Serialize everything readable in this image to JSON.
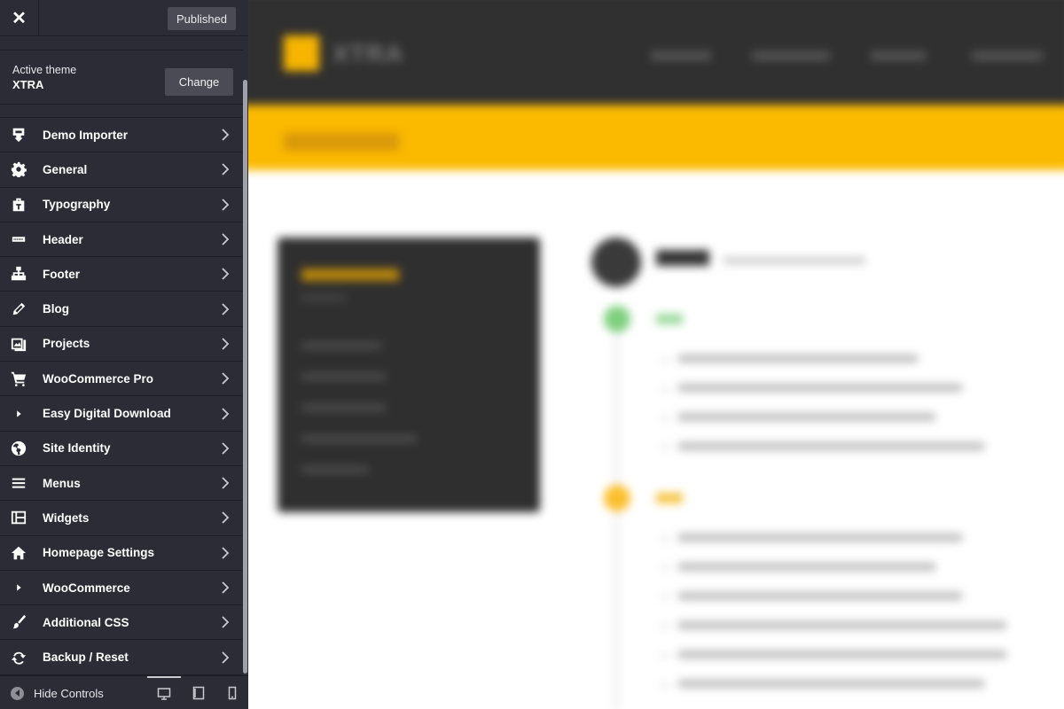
{
  "topbar": {
    "close_symbol": "✕",
    "publish_label": "Published"
  },
  "theme": {
    "label": "Active theme",
    "name": "XTRA",
    "change_label": "Change"
  },
  "menu": [
    {
      "label": "Demo Importer",
      "icon": "download-icon"
    },
    {
      "label": "General",
      "icon": "gear-icon"
    },
    {
      "label": "Typography",
      "icon": "font-icon"
    },
    {
      "label": "Header",
      "icon": "header-icon"
    },
    {
      "label": "Footer",
      "icon": "sitemap-icon"
    },
    {
      "label": "Blog",
      "icon": "pencil-icon"
    },
    {
      "label": "Projects",
      "icon": "portfolio-icon"
    },
    {
      "label": "WooCommerce Pro",
      "icon": "cart-icon"
    },
    {
      "label": "Easy Digital Download",
      "icon": "triangle-icon"
    },
    {
      "label": "Site Identity",
      "icon": "globe-icon"
    },
    {
      "label": "Menus",
      "icon": "menu-icon"
    },
    {
      "label": "Widgets",
      "icon": "widgets-icon"
    },
    {
      "label": "Homepage Settings",
      "icon": "home-icon"
    },
    {
      "label": "WooCommerce",
      "icon": "triangle-icon"
    },
    {
      "label": "Additional CSS",
      "icon": "brush-icon"
    },
    {
      "label": "Backup / Reset",
      "icon": "refresh-icon"
    }
  ],
  "footer": {
    "hide_label": "Hide Controls",
    "devices": [
      "desktop",
      "tablet",
      "mobile"
    ],
    "active_device": "desktop"
  },
  "colors": {
    "sidebar_bg": "#2b2c36",
    "accent": "#fbb900",
    "header_dark": "#303030"
  }
}
